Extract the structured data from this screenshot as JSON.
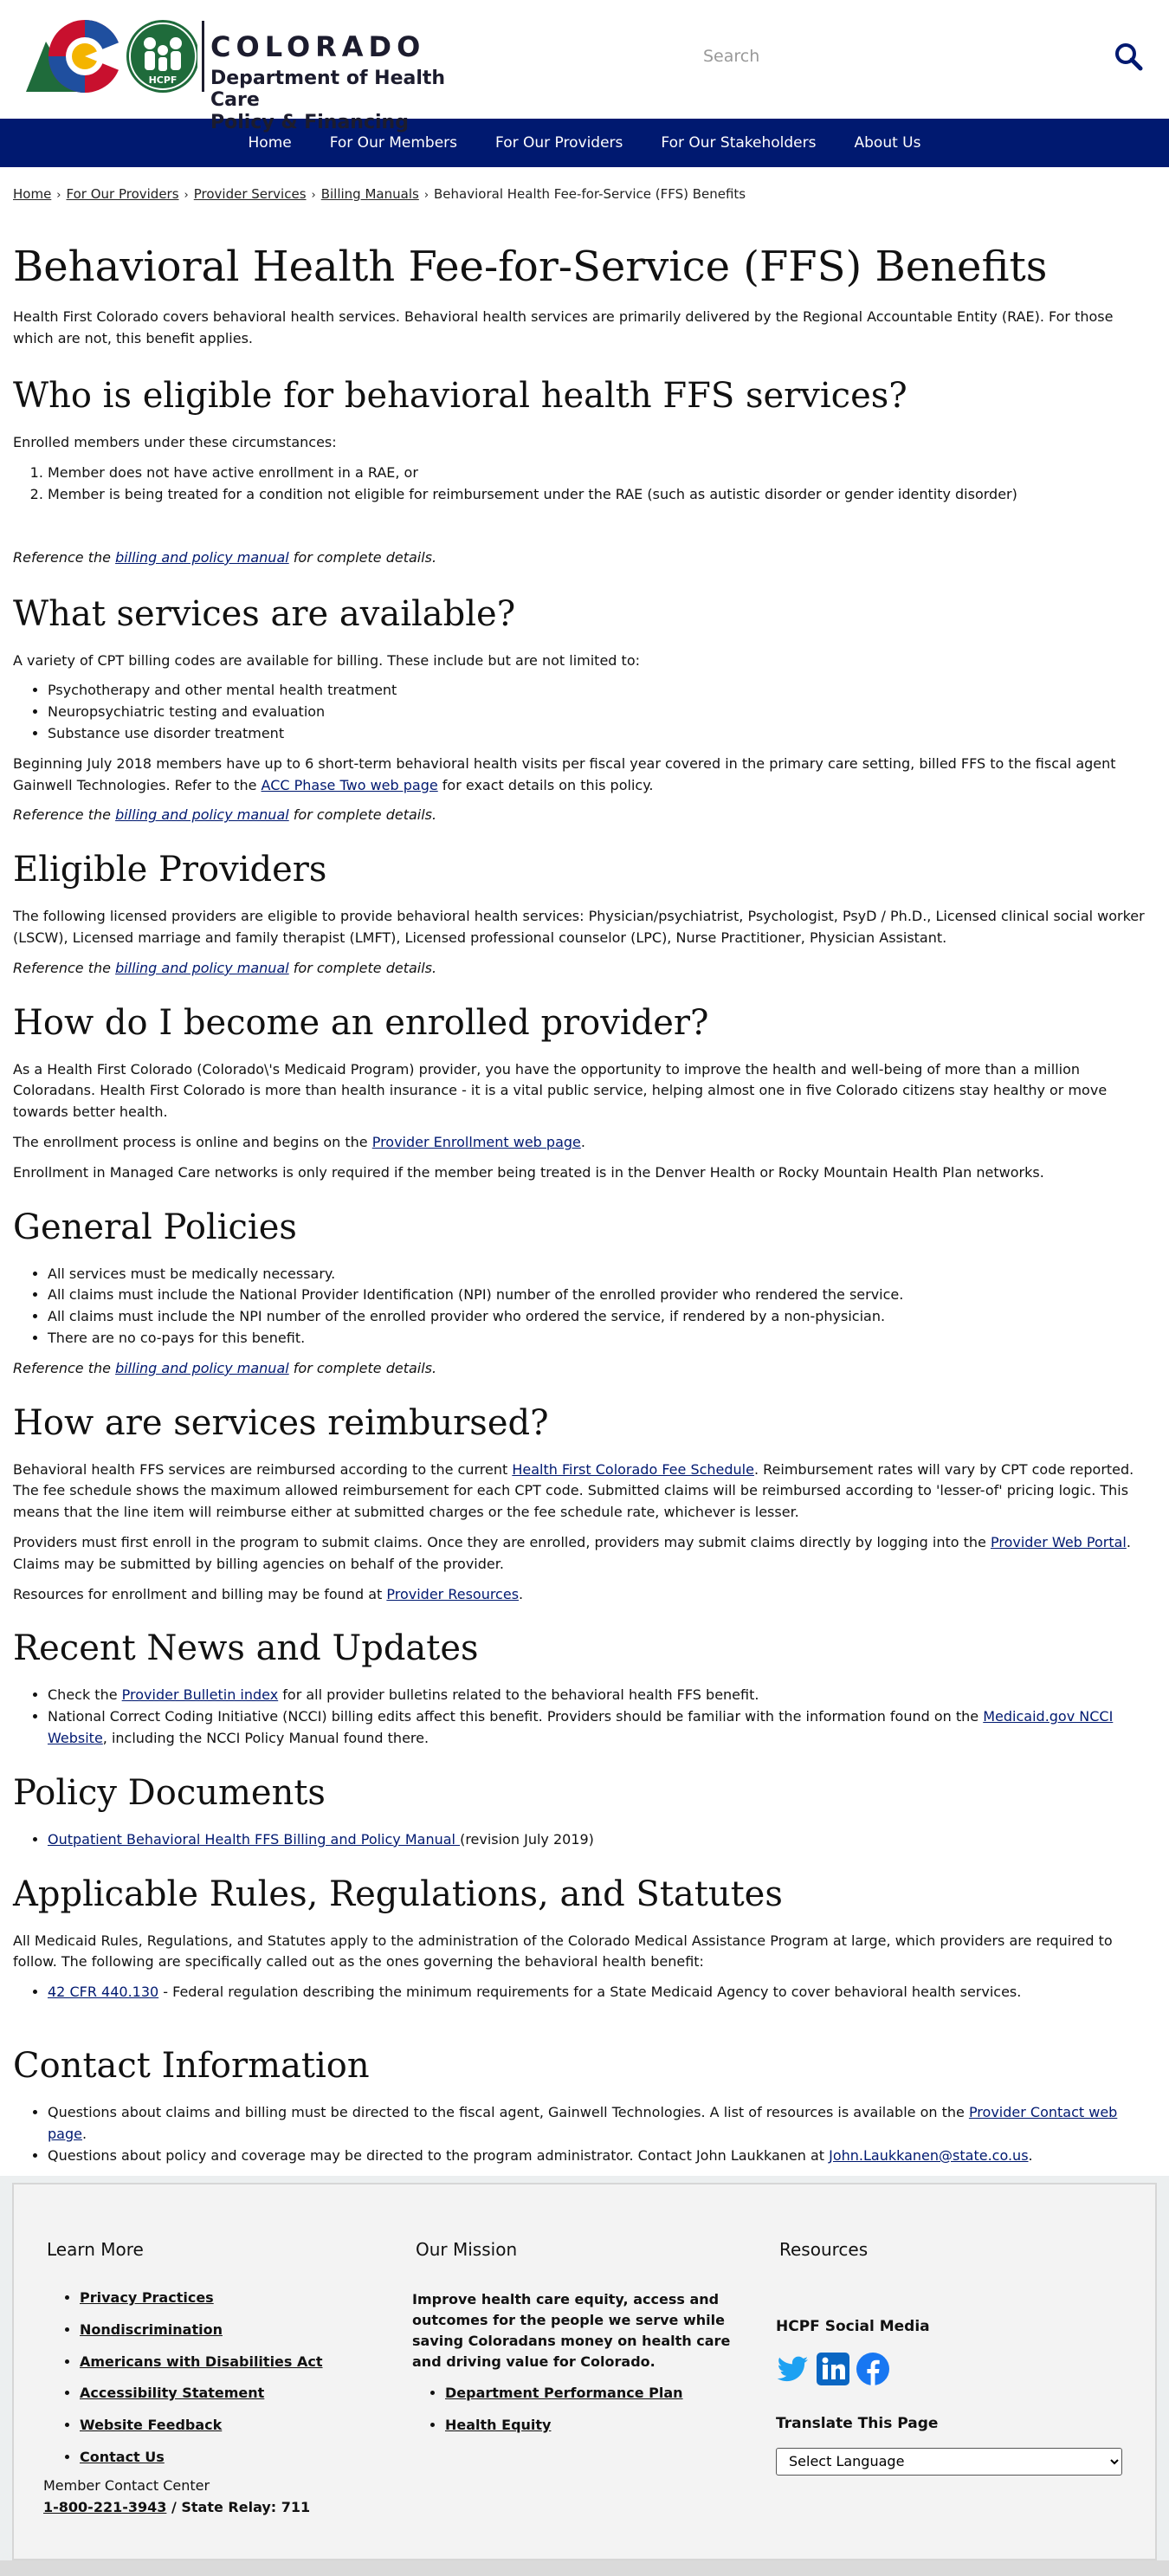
{
  "header": {
    "logo_title": "COLORADO",
    "logo_sub_line1": "Department of Health Care",
    "logo_sub_line2": "Policy & Financing",
    "logo_badge": "HCPF",
    "search_placeholder": "Search"
  },
  "nav": [
    "Home",
    "For Our Members",
    "For Our Providers",
    "For Our Stakeholders",
    "About Us"
  ],
  "breadcrumb": [
    "Home",
    "For Our Providers",
    "Provider Services",
    "Billing Manuals",
    "Behavioral Health Fee-for-Service (FFS) Benefits"
  ],
  "page": {
    "title": "Behavioral Health Fee-for-Service (FFS) Benefits",
    "intro": "Health First Colorado covers behavioral health services. Behavioral health services are primarily delivered by the Regional Accountable Entity (RAE). For those which are not, this benefit applies.",
    "ref_pre": "Reference the ",
    "ref_link": "billing and policy manual",
    "ref_post": " for complete details.",
    "eligible": {
      "heading": "Who is eligible for behavioral health FFS services?",
      "lead": "Enrolled members under these circumstances:",
      "items": [
        "Member does not have active enrollment in a RAE, or",
        "Member is being treated for a condition not eligible for reimbursement under the RAE (such as autistic disorder or gender identity disorder)"
      ]
    },
    "services": {
      "heading": "What services are available?",
      "lead": "A variety of CPT billing codes are available for billing. These include but are not limited to:",
      "items": [
        "Psychotherapy and other mental health treatment",
        "Neuropsychiatric testing and evaluation",
        "Substance use disorder treatment"
      ],
      "para1_pre": "Beginning July 2018 members have up to 6 short-term behavioral health visits per fiscal year covered in the primary care setting, billed FFS to the fiscal agent Gainwell Technologies. Refer to the ",
      "para1_link": "ACC Phase Two web page",
      "para1_post": " for exact details on this policy."
    },
    "providers": {
      "heading": "Eligible Providers",
      "text": "The following licensed providers are eligible to provide behavioral health services: Physician/psychiatrist, Psychologist, PsyD / Ph.D., Licensed clinical social worker (LSCW), Licensed marriage and family therapist (LMFT), Licensed professional counselor (LPC), Nurse Practitioner, Physician Assistant."
    },
    "enroll": {
      "heading": "How do I become an enrolled provider?",
      "p1": "As a Health First Colorado (Colorado\\'s Medicaid Program) provider, you have the opportunity to improve the health and well-being of more than a million Coloradans. Health First Colorado is more than health insurance - it is a vital public service, helping almost one in five Colorado citizens stay healthy or move towards better health.",
      "p2_pre": "The enrollment process is online and begins on the ",
      "p2_link": "Provider Enrollment web page",
      "p2_post": ".",
      "p3": "Enrollment in Managed Care networks is only required if the member being treated is in the Denver Health or Rocky Mountain Health Plan networks."
    },
    "policies": {
      "heading": "General Policies",
      "items": [
        "All services must be medically necessary.",
        "All claims must include the National Provider Identification (NPI) number of the enrolled provider who rendered the service.",
        "All claims must include the NPI number of the enrolled provider who ordered the service, if rendered by a non-physician.",
        "There are no co-pays for this benefit."
      ]
    },
    "reimb": {
      "heading": "How are services reimbursed?",
      "p1_pre": "Behavioral health FFS services are reimbursed according to the current ",
      "p1_link": "Health First Colorado Fee Schedule",
      "p1_post": ". Reimbursement rates will vary by CPT code reported. The fee schedule shows the maximum allowed reimbursement for each CPT code. Submitted claims will be reimbursed according to 'lesser-of' pricing logic. This means that the line item will reimburse either at submitted charges or the fee schedule rate, whichever is lesser.",
      "p2_pre": "Providers must first enroll in the program to submit claims. Once they are enrolled, providers may submit claims directly by logging into the ",
      "p2_link": "Provider Web Portal",
      "p2_post": ". Claims may be submitted by billing agencies on behalf of the provider.",
      "p3_pre": "Resources for enrollment and billing may be found at ",
      "p3_link": "Provider Resources",
      "p3_post": "."
    },
    "news": {
      "heading": "Recent News and Updates",
      "i1_pre": "Check the ",
      "i1_link": "Provider Bulletin index",
      "i1_post": " for all provider bulletins related to the behavioral health FFS benefit.",
      "i2_pre": "National Correct Coding Initiative (NCCI) billing edits affect this benefit. Providers should be familiar with the information found on the ",
      "i2_link": "Medicaid.gov NCCI Website",
      "i2_post": ", including the NCCI Policy Manual found there."
    },
    "docs": {
      "heading": "Policy Documents",
      "link": "Outpatient Behavioral Health FFS Billing and Policy Manual ",
      "post": "(revision July 2019)"
    },
    "rules": {
      "heading": "Applicable Rules, Regulations, and Statutes",
      "text": "All Medicaid Rules, Regulations, and Statutes apply to the administration of the Colorado Medical Assistance Program at large, which providers are required to follow. The following are specifically called out as the ones governing the behavioral health benefit:",
      "item_link": "42 CFR 440.130",
      "item_post": " - Federal regulation describing the minimum requirements for a State Medicaid Agency to cover behavioral health services."
    },
    "contact": {
      "heading": "Contact Information",
      "i1_pre": "Questions about claims and billing must be directed to the fiscal agent, Gainwell Technologies. A list of resources is available on the ",
      "i1_link": "Provider Contact web page",
      "i1_post": ".",
      "i2_pre": "Questions about policy and coverage may be directed to the program administrator. Contact John Laukkanen at ",
      "i2_link": "John.Laukkanen@state.co.us",
      "i2_post": "."
    }
  },
  "footer": {
    "learn_heading": "Learn More",
    "learn_links": [
      "Privacy Practices",
      "Nondiscrimination",
      "Americans with Disabilities Act",
      "Accessibility Statement",
      "Website Feedback",
      "Contact Us"
    ],
    "member_center": "Member Contact Center",
    "phone": "1-800-221-3943",
    "relay": " / State Relay: 711",
    "mission_heading": "Our Mission",
    "mission_text": "Improve health care equity, access and outcomes for the people we serve while saving Coloradans money on health care and driving value for Colorado.",
    "mission_links": [
      "Department Performance Plan",
      "Health Equity"
    ],
    "resources_heading": "Resources",
    "social_heading": "HCPF Social Media",
    "translate_heading": "Translate This Page",
    "select_value": "Select Language"
  },
  "colors": {
    "nav_bg": "#001970",
    "link": "#001970",
    "twitter": "#1DA1F2",
    "linkedin": "#0A66C2",
    "facebook": "#1877F2"
  }
}
